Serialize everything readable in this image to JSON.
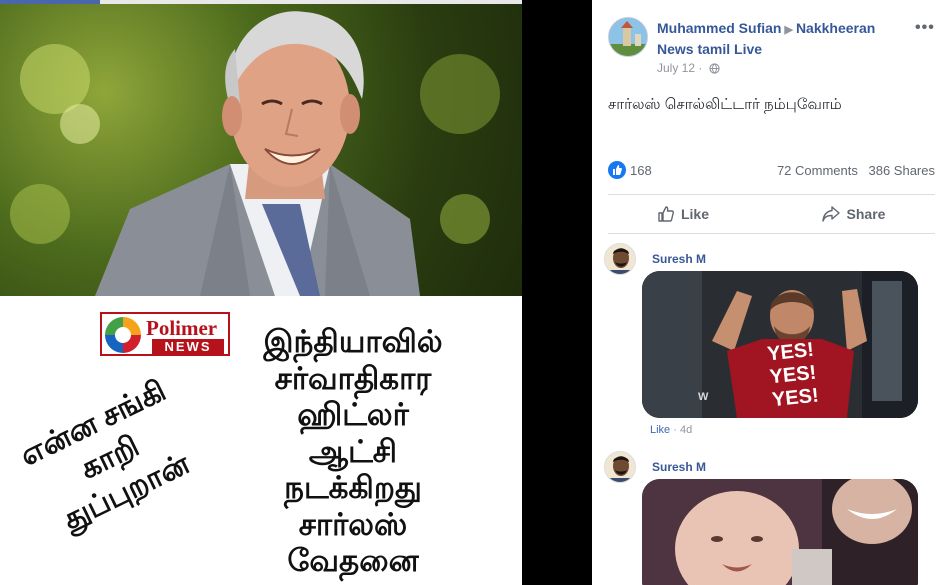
{
  "left_image": {
    "logo_name": "Polimer",
    "logo_news": "NEWS",
    "caption_lines": [
      "இந்தியாவில்",
      "சர்வாதிகார",
      "ஹிட்லர்",
      "ஆட்சி",
      "நடக்கிறது",
      "சார்லஸ்",
      "வேதனை"
    ],
    "slant_lines": [
      "என்ன சங்கி",
      "காறி",
      "துப்புறான்"
    ]
  },
  "post": {
    "author": "Muhammed Sufian",
    "target_page": "Nakkheeran News tamil Live",
    "date": "July 12",
    "text": "சார்லஸ் சொல்லிட்டார் நம்புவோம்",
    "reaction_count": "168",
    "comments_count": "72 Comments",
    "shares_count": "386 Shares",
    "like_label": "Like",
    "share_label": "Share",
    "more_icon": "more-horizontal-icon"
  },
  "comments": [
    {
      "author": "Suresh M",
      "gif_text": [
        "YES!",
        "YES!",
        "YES!"
      ],
      "gif_badge": "W",
      "like_label": "Like",
      "time": "4d"
    },
    {
      "author": "Suresh M"
    }
  ],
  "colors": {
    "link": "#365899",
    "accent": "#1877f2",
    "meta": "#90949c",
    "polimer_red": "#b5121b"
  }
}
